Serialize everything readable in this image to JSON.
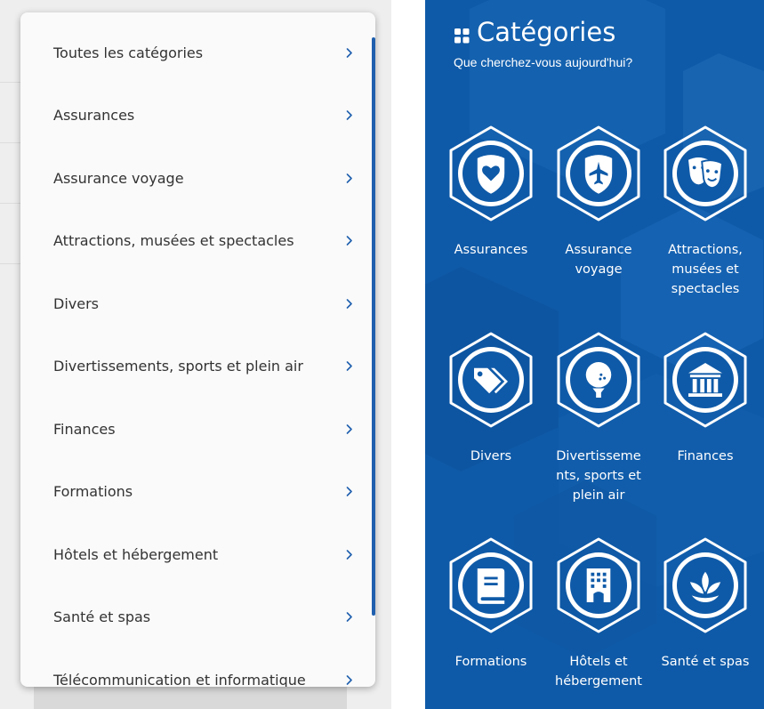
{
  "list": {
    "items": [
      {
        "label": "Toutes les catégories"
      },
      {
        "label": "Assurances"
      },
      {
        "label": "Assurance voyage"
      },
      {
        "label": "Attractions, musées et spectacles"
      },
      {
        "label": "Divers"
      },
      {
        "label": "Divertissements, sports et plein air"
      },
      {
        "label": "Finances"
      },
      {
        "label": "Formations"
      },
      {
        "label": "Hôtels et hébergement"
      },
      {
        "label": "Santé et spas"
      },
      {
        "label": "Télécommunication et informatique"
      }
    ],
    "chevron_icon": "chevron-right-icon",
    "accent_color": "#1f5fae"
  },
  "categories": {
    "title": "Catégories",
    "title_icon": "grid-icon",
    "subtitle": "Que cherchez-vous aujourd'hui?",
    "background_color": "#0f5aa8",
    "tiles": [
      {
        "label_lines": [
          "Assurances"
        ],
        "icon": "heart-shield-icon"
      },
      {
        "label_lines": [
          "Assurance",
          "voyage"
        ],
        "icon": "plane-shield-icon"
      },
      {
        "label_lines": [
          "Attractions,",
          "musées et",
          "spectacles"
        ],
        "icon": "theater-masks-icon"
      },
      {
        "label_lines": [
          "Divers"
        ],
        "icon": "tags-icon"
      },
      {
        "label_lines": [
          "Divertisseme",
          "nts, sports et",
          "plein air"
        ],
        "icon": "golf-ball-icon"
      },
      {
        "label_lines": [
          "Finances"
        ],
        "icon": "bank-icon"
      },
      {
        "label_lines": [
          "Formations"
        ],
        "icon": "book-icon"
      },
      {
        "label_lines": [
          "Hôtels et",
          "hébergement"
        ],
        "icon": "hotel-building-icon"
      },
      {
        "label_lines": [
          "Santé et spas"
        ],
        "icon": "lotus-icon"
      }
    ]
  }
}
